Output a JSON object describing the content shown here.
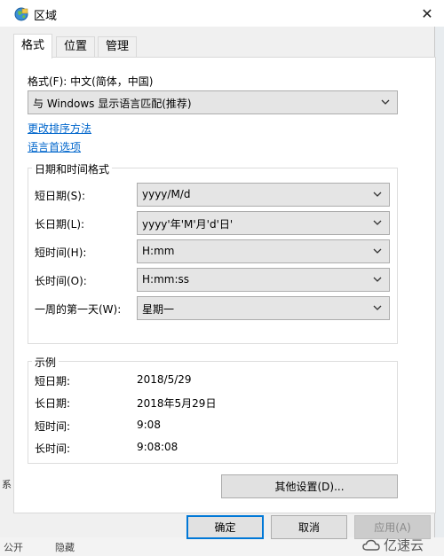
{
  "window": {
    "title": "区域",
    "close_glyph": "✕"
  },
  "tabs": [
    {
      "label": "格式",
      "active": true
    },
    {
      "label": "位置",
      "active": false
    },
    {
      "label": "管理",
      "active": false
    }
  ],
  "format": {
    "label": "格式(F): 中文(简体，中国)",
    "dropdown_value": "与 Windows 显示语言匹配(推荐)",
    "link_sort": "更改排序方法",
    "link_language": "语言首选项"
  },
  "datetime_group": {
    "title": "日期和时间格式",
    "rows": [
      {
        "label": "短日期(S):",
        "value": "yyyy/M/d"
      },
      {
        "label": "长日期(L):",
        "value": "yyyy'年'M'月'd'日'"
      },
      {
        "label": "短时间(H):",
        "value": "H:mm"
      },
      {
        "label": "长时间(O):",
        "value": "H:mm:ss"
      },
      {
        "label": "一周的第一天(W):",
        "value": "星期一"
      }
    ]
  },
  "examples_group": {
    "title": "示例",
    "rows": [
      {
        "label": "短日期:",
        "value": "2018/5/29"
      },
      {
        "label": "长日期:",
        "value": "2018年5月29日"
      },
      {
        "label": "短时间:",
        "value": "9:08"
      },
      {
        "label": "长时间:",
        "value": "9:08:08"
      }
    ]
  },
  "buttons": {
    "other_settings": "其他设置(D)...",
    "ok": "确定",
    "cancel": "取消",
    "apply": "应用(A)"
  },
  "background_fragments": {
    "bottom_left": "公开",
    "bottom_mid": "隐藏",
    "left_edge": "系"
  },
  "watermark": {
    "text": "亿速云",
    "icon": "cloud-logo-icon"
  },
  "colors": {
    "link": "#0066cc",
    "default_button_border": "#0078d7"
  }
}
